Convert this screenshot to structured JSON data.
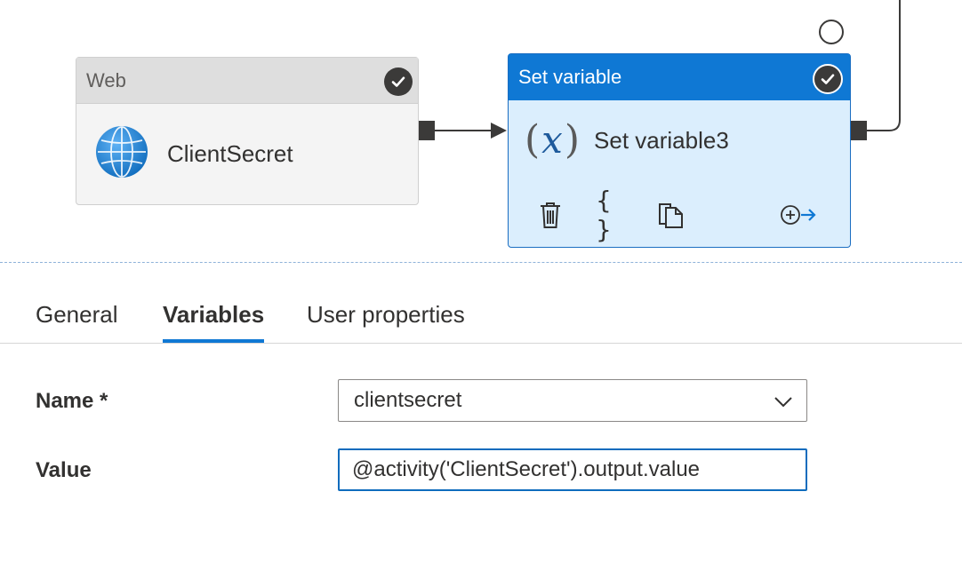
{
  "canvas": {
    "activities": [
      {
        "type_label": "Web",
        "name": "ClientSecret",
        "status": "succeeded",
        "icon": "globe-icon"
      },
      {
        "type_label": "Set variable",
        "name": "Set variable3",
        "status": "succeeded",
        "icon": "fx-variable-icon",
        "selected": true
      }
    ],
    "toolbar_icons": [
      "delete-icon",
      "code-braces-icon",
      "copy-icon",
      "add-output-icon"
    ],
    "colors": {
      "accent": "#0f78d4",
      "selected_fill": "#dbeefd",
      "node_header": "#dedede"
    }
  },
  "tabs": [
    {
      "label": "General",
      "active": false
    },
    {
      "label": "Variables",
      "active": true
    },
    {
      "label": "User properties",
      "active": false
    }
  ],
  "form": {
    "name_label": "Name *",
    "name_value": "clientsecret",
    "value_label": "Value",
    "value_text": "@activity('ClientSecret').output.value"
  }
}
